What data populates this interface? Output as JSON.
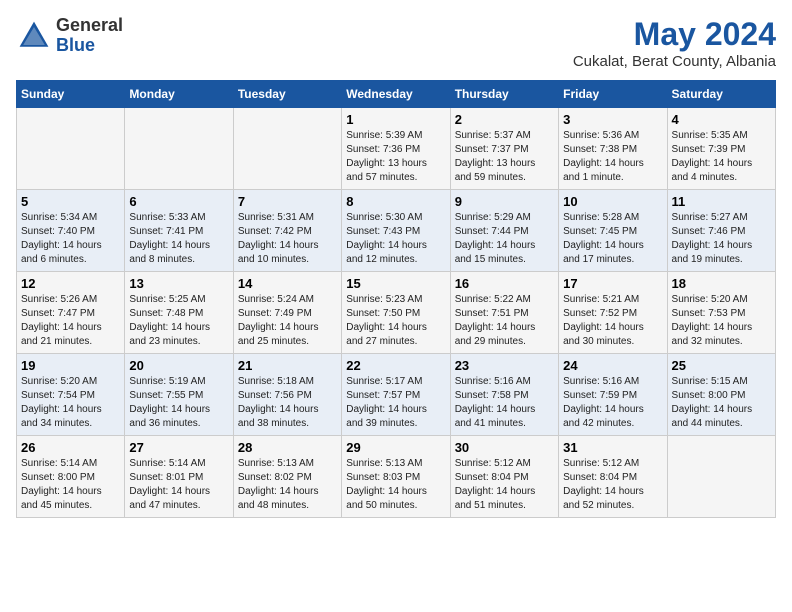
{
  "header": {
    "logo_line1": "General",
    "logo_line2": "Blue",
    "month": "May 2024",
    "location": "Cukalat, Berat County, Albania"
  },
  "days_of_week": [
    "Sunday",
    "Monday",
    "Tuesday",
    "Wednesday",
    "Thursday",
    "Friday",
    "Saturday"
  ],
  "weeks": [
    [
      {
        "day": "",
        "info": ""
      },
      {
        "day": "",
        "info": ""
      },
      {
        "day": "",
        "info": ""
      },
      {
        "day": "1",
        "info": "Sunrise: 5:39 AM\nSunset: 7:36 PM\nDaylight: 13 hours\nand 57 minutes."
      },
      {
        "day": "2",
        "info": "Sunrise: 5:37 AM\nSunset: 7:37 PM\nDaylight: 13 hours\nand 59 minutes."
      },
      {
        "day": "3",
        "info": "Sunrise: 5:36 AM\nSunset: 7:38 PM\nDaylight: 14 hours\nand 1 minute."
      },
      {
        "day": "4",
        "info": "Sunrise: 5:35 AM\nSunset: 7:39 PM\nDaylight: 14 hours\nand 4 minutes."
      }
    ],
    [
      {
        "day": "5",
        "info": "Sunrise: 5:34 AM\nSunset: 7:40 PM\nDaylight: 14 hours\nand 6 minutes."
      },
      {
        "day": "6",
        "info": "Sunrise: 5:33 AM\nSunset: 7:41 PM\nDaylight: 14 hours\nand 8 minutes."
      },
      {
        "day": "7",
        "info": "Sunrise: 5:31 AM\nSunset: 7:42 PM\nDaylight: 14 hours\nand 10 minutes."
      },
      {
        "day": "8",
        "info": "Sunrise: 5:30 AM\nSunset: 7:43 PM\nDaylight: 14 hours\nand 12 minutes."
      },
      {
        "day": "9",
        "info": "Sunrise: 5:29 AM\nSunset: 7:44 PM\nDaylight: 14 hours\nand 15 minutes."
      },
      {
        "day": "10",
        "info": "Sunrise: 5:28 AM\nSunset: 7:45 PM\nDaylight: 14 hours\nand 17 minutes."
      },
      {
        "day": "11",
        "info": "Sunrise: 5:27 AM\nSunset: 7:46 PM\nDaylight: 14 hours\nand 19 minutes."
      }
    ],
    [
      {
        "day": "12",
        "info": "Sunrise: 5:26 AM\nSunset: 7:47 PM\nDaylight: 14 hours\nand 21 minutes."
      },
      {
        "day": "13",
        "info": "Sunrise: 5:25 AM\nSunset: 7:48 PM\nDaylight: 14 hours\nand 23 minutes."
      },
      {
        "day": "14",
        "info": "Sunrise: 5:24 AM\nSunset: 7:49 PM\nDaylight: 14 hours\nand 25 minutes."
      },
      {
        "day": "15",
        "info": "Sunrise: 5:23 AM\nSunset: 7:50 PM\nDaylight: 14 hours\nand 27 minutes."
      },
      {
        "day": "16",
        "info": "Sunrise: 5:22 AM\nSunset: 7:51 PM\nDaylight: 14 hours\nand 29 minutes."
      },
      {
        "day": "17",
        "info": "Sunrise: 5:21 AM\nSunset: 7:52 PM\nDaylight: 14 hours\nand 30 minutes."
      },
      {
        "day": "18",
        "info": "Sunrise: 5:20 AM\nSunset: 7:53 PM\nDaylight: 14 hours\nand 32 minutes."
      }
    ],
    [
      {
        "day": "19",
        "info": "Sunrise: 5:20 AM\nSunset: 7:54 PM\nDaylight: 14 hours\nand 34 minutes."
      },
      {
        "day": "20",
        "info": "Sunrise: 5:19 AM\nSunset: 7:55 PM\nDaylight: 14 hours\nand 36 minutes."
      },
      {
        "day": "21",
        "info": "Sunrise: 5:18 AM\nSunset: 7:56 PM\nDaylight: 14 hours\nand 38 minutes."
      },
      {
        "day": "22",
        "info": "Sunrise: 5:17 AM\nSunset: 7:57 PM\nDaylight: 14 hours\nand 39 minutes."
      },
      {
        "day": "23",
        "info": "Sunrise: 5:16 AM\nSunset: 7:58 PM\nDaylight: 14 hours\nand 41 minutes."
      },
      {
        "day": "24",
        "info": "Sunrise: 5:16 AM\nSunset: 7:59 PM\nDaylight: 14 hours\nand 42 minutes."
      },
      {
        "day": "25",
        "info": "Sunrise: 5:15 AM\nSunset: 8:00 PM\nDaylight: 14 hours\nand 44 minutes."
      }
    ],
    [
      {
        "day": "26",
        "info": "Sunrise: 5:14 AM\nSunset: 8:00 PM\nDaylight: 14 hours\nand 45 minutes."
      },
      {
        "day": "27",
        "info": "Sunrise: 5:14 AM\nSunset: 8:01 PM\nDaylight: 14 hours\nand 47 minutes."
      },
      {
        "day": "28",
        "info": "Sunrise: 5:13 AM\nSunset: 8:02 PM\nDaylight: 14 hours\nand 48 minutes."
      },
      {
        "day": "29",
        "info": "Sunrise: 5:13 AM\nSunset: 8:03 PM\nDaylight: 14 hours\nand 50 minutes."
      },
      {
        "day": "30",
        "info": "Sunrise: 5:12 AM\nSunset: 8:04 PM\nDaylight: 14 hours\nand 51 minutes."
      },
      {
        "day": "31",
        "info": "Sunrise: 5:12 AM\nSunset: 8:04 PM\nDaylight: 14 hours\nand 52 minutes."
      },
      {
        "day": "",
        "info": ""
      }
    ]
  ]
}
